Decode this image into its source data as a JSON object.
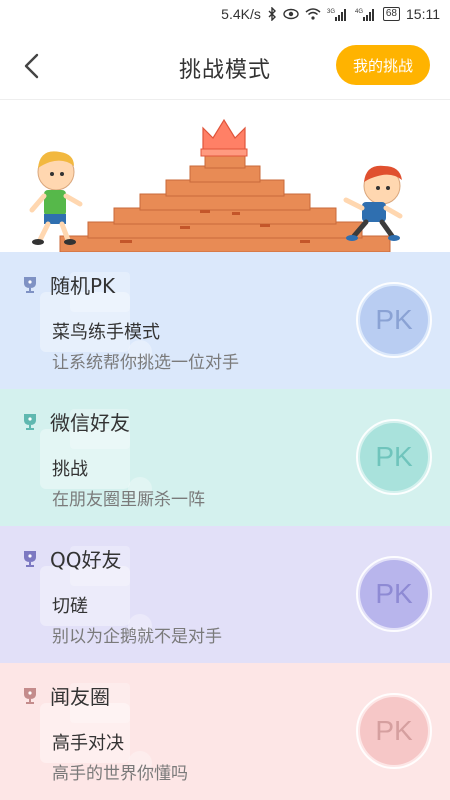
{
  "status_bar": {
    "net_speed": "5.4K/s",
    "battery": "68",
    "time": "15:11",
    "signal_labels": [
      "3G",
      "4G"
    ]
  },
  "nav": {
    "title": "挑战模式",
    "back_icon": "chevron-left-icon",
    "my_challenge_label": "我的挑战",
    "accent": "#ffb300"
  },
  "modes": [
    {
      "title": "随机PK",
      "subtitle": "菜鸟练手模式",
      "description": "让系统帮你挑选一位对手",
      "button": "PK",
      "bg": "#dbe8fb",
      "accent": "#7f92c4",
      "btn_bg": "#b9cdf2",
      "btn_text": "#8aa2d4"
    },
    {
      "title": "微信好友",
      "subtitle": "挑战",
      "description": "在朋友圈里厮杀一阵",
      "button": "PK",
      "bg": "#d4f1ee",
      "accent": "#5fb8b0",
      "btn_bg": "#a9e2dc",
      "btn_text": "#6fc4bc"
    },
    {
      "title": "QQ好友",
      "subtitle": "切磋",
      "description": "别以为企鹅就不是对手",
      "button": "PK",
      "bg": "#e2e0f8",
      "accent": "#7d79c2",
      "btn_bg": "#b8b5ec",
      "btn_text": "#8e8ad4"
    },
    {
      "title": "闻友圈",
      "subtitle": "高手对决",
      "description": "高手的世界你懂吗",
      "button": "PK",
      "bg": "#fde6e6",
      "accent": "#c48c8c",
      "btn_bg": "#f6c7c7",
      "btn_text": "#d59f9f"
    }
  ]
}
